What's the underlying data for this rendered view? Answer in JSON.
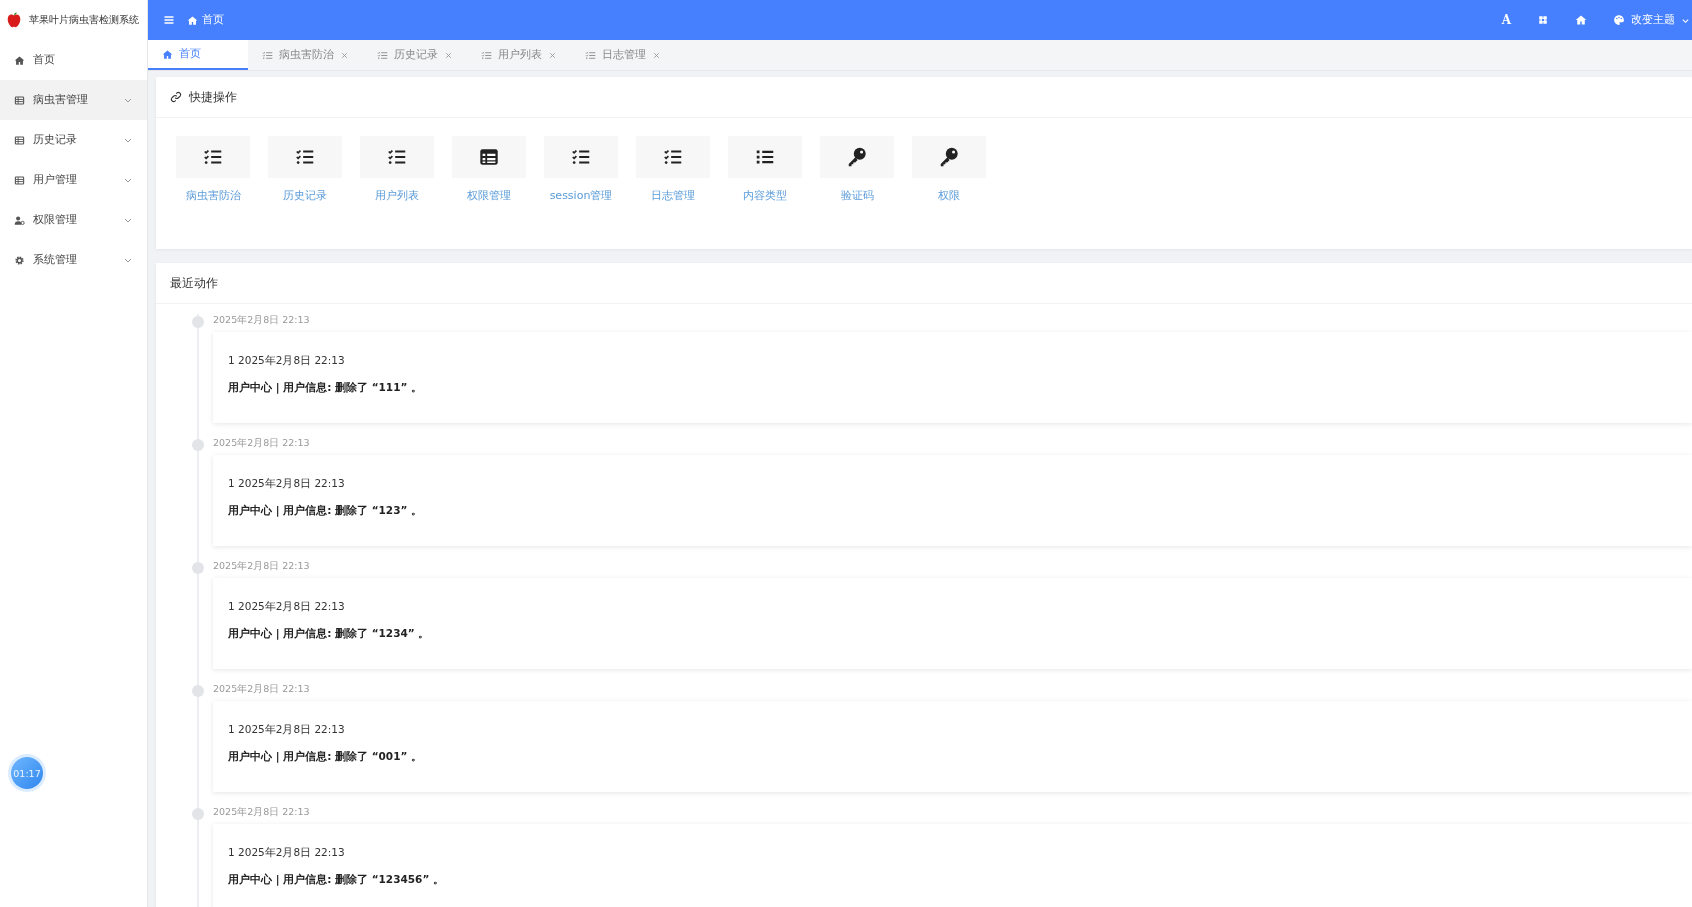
{
  "app": {
    "title": "苹果叶片病虫害检测系统"
  },
  "sidebar": {
    "items": [
      {
        "label": "首页",
        "kind": "home",
        "highlighted": false
      },
      {
        "label": "病虫害管理",
        "kind": "table",
        "highlighted": true
      },
      {
        "label": "历史记录",
        "kind": "table",
        "highlighted": false
      },
      {
        "label": "用户管理",
        "kind": "table",
        "highlighted": false
      },
      {
        "label": "权限管理",
        "kind": "user",
        "highlighted": false
      },
      {
        "label": "系统管理",
        "kind": "gear",
        "highlighted": false
      }
    ],
    "timer": "01:17"
  },
  "header": {
    "breadcrumb": "首页",
    "font_button": "A",
    "theme_label": "改变主题"
  },
  "tabs": [
    {
      "label": "首页",
      "kind": "home",
      "selected": true
    },
    {
      "label": "病虫害防治",
      "kind": "page",
      "selected": false
    },
    {
      "label": "历史记录",
      "kind": "page",
      "selected": false
    },
    {
      "label": "用户列表",
      "kind": "page",
      "selected": false
    },
    {
      "label": "日志管理",
      "kind": "page",
      "selected": false
    }
  ],
  "quick_actions": {
    "title": "快捷操作",
    "items": [
      {
        "label": "病虫害防治",
        "kind": "checklist"
      },
      {
        "label": "历史记录",
        "kind": "checklist"
      },
      {
        "label": "用户列表",
        "kind": "checklist"
      },
      {
        "label": "权限管理",
        "kind": "table"
      },
      {
        "label": "session管理",
        "kind": "checklist"
      },
      {
        "label": "日志管理",
        "kind": "checklist"
      },
      {
        "label": "内容类型",
        "kind": "list"
      },
      {
        "label": "验证码",
        "kind": "key"
      },
      {
        "label": "权限",
        "kind": "key"
      }
    ]
  },
  "recent_actions": {
    "title": "最近动作",
    "items": [
      {
        "timestamp": "2025年2月8日 22:13",
        "heading": "1 2025年2月8日 22:13",
        "message": "用户中心 | 用户信息: 删除了 “111” 。"
      },
      {
        "timestamp": "2025年2月8日 22:13",
        "heading": "1 2025年2月8日 22:13",
        "message": "用户中心 | 用户信息: 删除了 “123” 。"
      },
      {
        "timestamp": "2025年2月8日 22:13",
        "heading": "1 2025年2月8日 22:13",
        "message": "用户中心 | 用户信息: 删除了 “1234” 。"
      },
      {
        "timestamp": "2025年2月8日 22:13",
        "heading": "1 2025年2月8日 22:13",
        "message": "用户中心 | 用户信息: 删除了 “001” 。"
      },
      {
        "timestamp": "2025年2月8日 22:13",
        "heading": "1 2025年2月8日 22:13",
        "message": "用户中心 | 用户信息: 删除了 “123456” 。"
      }
    ]
  }
}
